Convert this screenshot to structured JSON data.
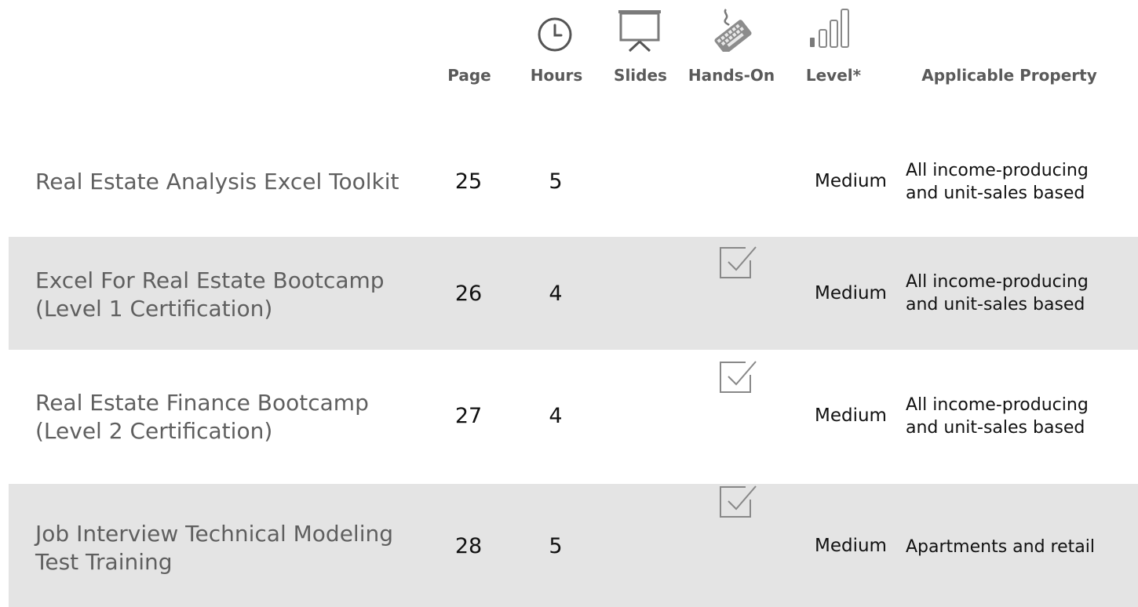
{
  "header": {
    "page": "Page",
    "hours": "Hours",
    "slides": "Slides",
    "hands_on": "Hands-On",
    "level": "Level*",
    "property": "Applicable Property"
  },
  "icons": {
    "hours": "clock-icon",
    "slides": "presentation-screen-icon",
    "hands_on": "keyboard-icon",
    "level": "signal-bars-icon"
  },
  "rows": [
    {
      "title_line1": "Real Estate Analysis Excel Toolkit",
      "title_line2": "",
      "page": "25",
      "hours": "5",
      "hands_on": false,
      "level": "Medium",
      "property_line1": "All income-producing",
      "property_line2": "and unit-sales based"
    },
    {
      "title_line1": "Excel For Real Estate Bootcamp",
      "title_line2": "(Level 1 Certification)",
      "page": "26",
      "hours": "4",
      "hands_on": true,
      "level": "Medium",
      "property_line1": "All income-producing",
      "property_line2": "and unit-sales based"
    },
    {
      "title_line1": "Real Estate Finance Bootcamp",
      "title_line2": "(Level 2 Certification)",
      "page": "27",
      "hours": "4",
      "hands_on": true,
      "level": "Medium",
      "property_line1": "All income-producing",
      "property_line2": "and unit-sales based"
    },
    {
      "title_line1": "Job Interview Technical Modeling",
      "title_line2": "Test Training",
      "page": "28",
      "hours": "5",
      "hands_on": true,
      "level": "Medium",
      "property_line1": "Apartments and retail",
      "property_line2": ""
    }
  ],
  "colors": {
    "shaded_row": "#e4e4e4",
    "icon_gray": "#7a7a7a",
    "title_gray": "#5f5f5f"
  }
}
